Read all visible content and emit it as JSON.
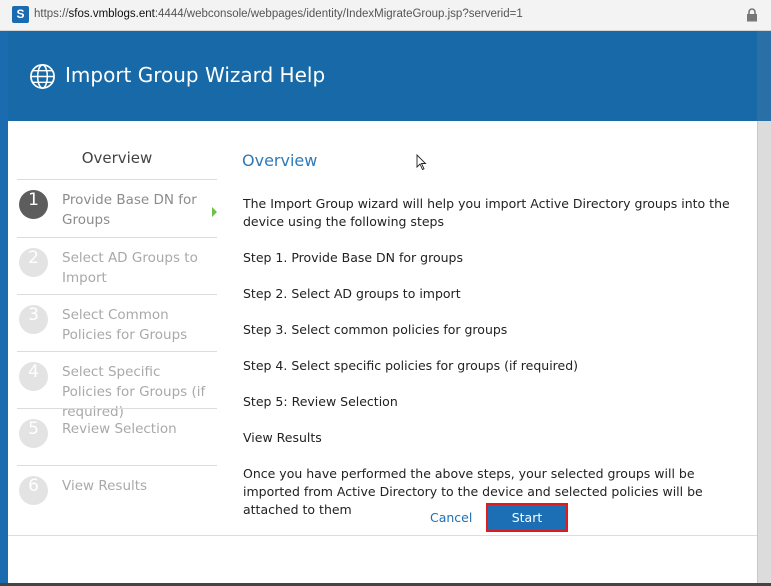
{
  "browser": {
    "url_prefix": "https://",
    "url_host": "sfos.vmblogs.ent",
    "url_rest": ":4444/webconsole/webpages/identity/IndexMigrateGroup.jsp?serverid=1",
    "site_badge": "S",
    "lock_icon": "lock-icon"
  },
  "header": {
    "title": "Import Group Wizard Help",
    "icon": "globe-icon",
    "color": "#176aa7"
  },
  "sidebar": {
    "title": "Overview",
    "steps": [
      {
        "num": "1",
        "label": "Provide Base DN for Groups",
        "active": true
      },
      {
        "num": "2",
        "label": "Select AD Groups to Import",
        "active": false
      },
      {
        "num": "3",
        "label": "Select Common Policies for Groups",
        "active": false
      },
      {
        "num": "4",
        "label": "Select Specific Policies for Groups (if required)",
        "active": false
      },
      {
        "num": "5",
        "label": "Review Selection",
        "active": false
      },
      {
        "num": "6",
        "label": "View Results",
        "active": false
      }
    ]
  },
  "content": {
    "title": "Overview",
    "intro": "The Import Group wizard will help you import Active Directory groups into the device using the following steps",
    "step1": "Step 1. Provide Base DN for groups",
    "step2": "Step 2. Select AD groups to import",
    "step3": "Step 3. Select common policies for groups",
    "step4": "Step 4. Select specific policies for groups (if required)",
    "step5": "Step 5: Review Selection",
    "results": "View Results",
    "outro": "Once you have performed the above steps, your selected groups will be imported from Active Directory to the device and selected policies will be attached to them"
  },
  "actions": {
    "cancel_label": "Cancel",
    "start_label": "Start",
    "start_color": "#1d6fb5",
    "highlight_color": "#e01b1b"
  }
}
